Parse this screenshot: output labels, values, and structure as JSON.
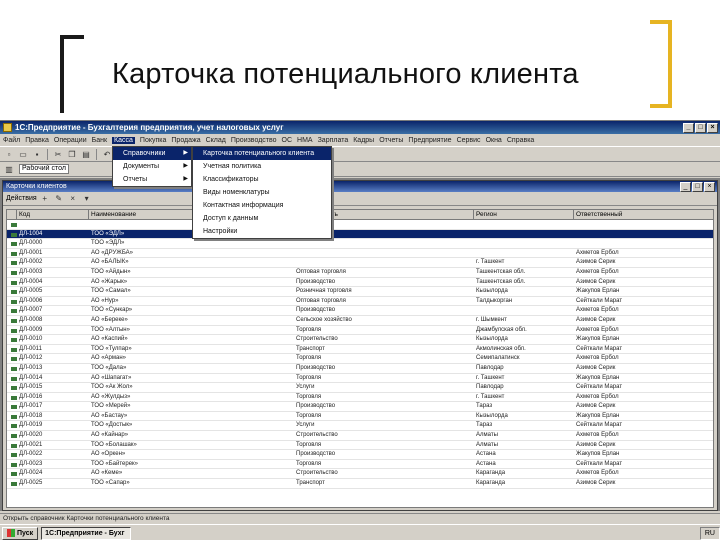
{
  "slide": {
    "title": "Карточка потенциального клиента"
  },
  "window": {
    "title": "1С:Предприятие - Бухгалтерия предприятия, учет налоговых услуг"
  },
  "menubar": [
    "Файл",
    "Правка",
    "Операции",
    "Банк",
    "Касса",
    "Покупка",
    "Продажа",
    "Склад",
    "Производство",
    "ОС",
    "НМА",
    "Зарплата",
    "Кадры",
    "Отчеты",
    "Предприятие",
    "Сервис",
    "Окна",
    "Справка"
  ],
  "child_window": {
    "title": "Карточки клиентов",
    "toolbar_label": "Действия"
  },
  "toolbar2": {
    "field": "Рабочий стол"
  },
  "grid": {
    "headers": [
      "",
      "Код",
      "Наименование",
      "Деятельность",
      "Регион",
      "Ответственный"
    ],
    "rows": [
      [
        "",
        "",
        "",
        "",
        "",
        ""
      ],
      [
        "",
        "ДЛ-1004",
        "ТОО «ЭДЛ»",
        "",
        "",
        ""
      ],
      [
        "",
        "ДЛ-0000",
        "TOO «ЭДЛ»",
        "",
        "",
        ""
      ],
      [
        "",
        "ДЛ-0001",
        "АО «ДРУЖБА»",
        "",
        "",
        "Ахметов Ербол"
      ],
      [
        "",
        "ДЛ-0002",
        "АО «БАЛЫК»",
        "",
        "г. Ташкент",
        "Азимов Серик"
      ],
      [
        "",
        "ДЛ-0003",
        "ТОО «Айдын»",
        "Оптовая торговля",
        "Ташкентская обл.",
        "Ахметов Ербол"
      ],
      [
        "",
        "ДЛ-0004",
        "АО «Жарык»",
        "Производство",
        "Ташкентская обл.",
        "Азимов Серик"
      ],
      [
        "",
        "ДЛ-0005",
        "ТОО «Самал»",
        "Розничная торговля",
        "Кызылорда",
        "Жакупов Ерлан"
      ],
      [
        "",
        "ДЛ-0006",
        "АО «Нур»",
        "Оптовая торговля",
        "Талдыкорган",
        "Сейткали Марат"
      ],
      [
        "",
        "ДЛ-0007",
        "ТОО «Сункар»",
        "Производство",
        "",
        "Ахметов Ербол"
      ],
      [
        "",
        "ДЛ-0008",
        "АО «Береке»",
        "Сельское хозяйство",
        "г. Шымкент",
        "Азимов Серик"
      ],
      [
        "",
        "ДЛ-0009",
        "ТОО «Алтын»",
        "Торговля",
        "Джамбулская обл.",
        "Ахметов Ербол"
      ],
      [
        "",
        "ДЛ-0010",
        "АО «Каспий»",
        "Строительство",
        "Кызылорда",
        "Жакупов Ерлан"
      ],
      [
        "",
        "ДЛ-0011",
        "ТОО «Тулпар»",
        "Транспорт",
        "Акмолинская обл.",
        "Сейткали Марат"
      ],
      [
        "",
        "ДЛ-0012",
        "АО «Арман»",
        "Торговля",
        "Семипалатинск",
        "Ахметов Ербол"
      ],
      [
        "",
        "ДЛ-0013",
        "ТОО «Дала»",
        "Производство",
        "Павлодар",
        "Азимов Серик"
      ],
      [
        "",
        "ДЛ-0014",
        "АО «Шапагат»",
        "Торговля",
        "г. Ташкент",
        "Жакупов Ерлан"
      ],
      [
        "",
        "ДЛ-0015",
        "ТОО «Ак Жол»",
        "Услуги",
        "Павлодар",
        "Сейткали Марат"
      ],
      [
        "",
        "ДЛ-0016",
        "АО «Жулдыз»",
        "Торговля",
        "г. Ташкент",
        "Ахметов Ербол"
      ],
      [
        "",
        "ДЛ-0017",
        "ТОО «Мерей»",
        "Производство",
        "Тараз",
        "Азимов Серик"
      ],
      [
        "",
        "ДЛ-0018",
        "АО «Бастау»",
        "Торговля",
        "Кызылорда",
        "Жакупов Ерлан"
      ],
      [
        "",
        "ДЛ-0019",
        "ТОО «Достык»",
        "Услуги",
        "Тараз",
        "Сейткали Марат"
      ],
      [
        "",
        "ДЛ-0020",
        "АО «Кайнар»",
        "Строительство",
        "Алматы",
        "Ахметов Ербол"
      ],
      [
        "",
        "ДЛ-0021",
        "ТОО «Болашак»",
        "Торговля",
        "Алматы",
        "Азимов Серик"
      ],
      [
        "",
        "ДЛ-0022",
        "АО «Оркен»",
        "Производство",
        "Астана",
        "Жакупов Ерлан"
      ],
      [
        "",
        "ДЛ-0023",
        "ТОО «Байтерек»",
        "Торговля",
        "Астана",
        "Сейткали Марат"
      ],
      [
        "",
        "ДЛ-0024",
        "АО «Кеме»",
        "Строительство",
        "Караганда",
        "Ахметов Ербол"
      ],
      [
        "",
        "ДЛ-0025",
        "ТОО «Сапар»",
        "Транспорт",
        "Караганда",
        "Азимов Серик"
      ]
    ]
  },
  "menu1": [
    "Справочники",
    "Документы",
    "Отчеты"
  ],
  "menu2": [
    "Карточка потенциального клиента"
  ],
  "menu3": [
    "Учетная политика",
    "Классификаторы",
    "Виды номенклатуры",
    "Контактная информация",
    "Доступ к данным",
    "Настройки"
  ],
  "statusbar": {
    "text": "Открыть справочник Карточки потенциального клиента"
  },
  "taskbar": {
    "start": "Пуск",
    "task": "1С:Предприятие - Бухг",
    "tray": "RU"
  },
  "colors": {
    "bracket_left": "#1a1a1a",
    "bracket_right": "#e6b422",
    "titlebar": "#0a246a"
  }
}
